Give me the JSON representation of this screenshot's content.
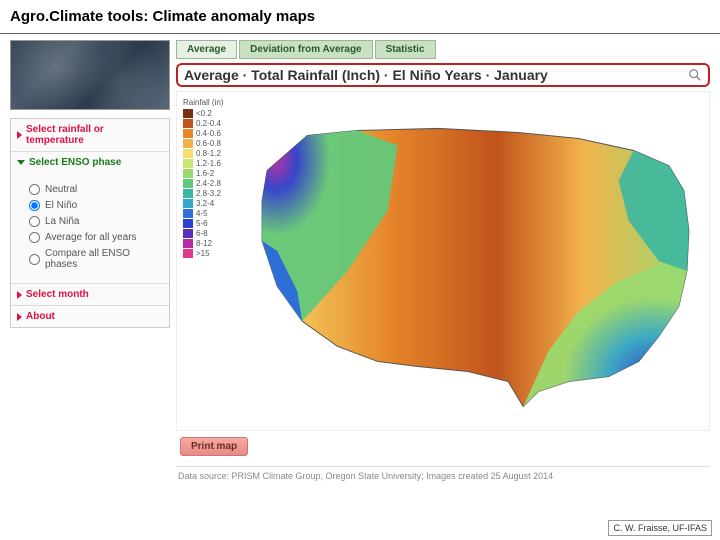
{
  "title": "Agro.Climate tools: Climate anomaly maps",
  "sidebar": {
    "items": [
      {
        "label": "Select rainfall or temperature",
        "open": false
      },
      {
        "label": "Select ENSO phase",
        "open": true
      },
      {
        "label": "Select month",
        "open": false
      },
      {
        "label": "About",
        "open": false
      }
    ],
    "enso_options": [
      {
        "label": "Neutral",
        "checked": false
      },
      {
        "label": "El Niño",
        "checked": true
      },
      {
        "label": "La Niña",
        "checked": false
      },
      {
        "label": "Average for all years",
        "checked": false
      },
      {
        "label": "Compare all ENSO phases",
        "checked": false
      }
    ]
  },
  "tabs": [
    {
      "label": "Average",
      "active": true
    },
    {
      "label": "Deviation from Average",
      "active": false
    },
    {
      "label": "Statistic",
      "active": false
    }
  ],
  "subtitle": "Average · Total Rainfall (Inch) · El Niño Years · January",
  "legend": {
    "title": "Rainfall (in)",
    "rows": [
      {
        "color": "#7a2f12",
        "label": "<0.2"
      },
      {
        "color": "#c1541b",
        "label": "0.2-0.4"
      },
      {
        "color": "#e6852a",
        "label": "0.4-0.6"
      },
      {
        "color": "#f2b24b",
        "label": "0.6-0.8"
      },
      {
        "color": "#f5df6a",
        "label": "0.8-1.2"
      },
      {
        "color": "#cbe66e",
        "label": "1.2-1.6"
      },
      {
        "color": "#9ad96e",
        "label": "1.6-2"
      },
      {
        "color": "#63c97a",
        "label": "2.4-2.8"
      },
      {
        "color": "#3cb7a0",
        "label": "2.8-3.2"
      },
      {
        "color": "#34a6c9",
        "label": "3.2-4"
      },
      {
        "color": "#2e6fd6",
        "label": "4-5"
      },
      {
        "color": "#2d3fd0",
        "label": "5-6"
      },
      {
        "color": "#5a2fb8",
        "label": "6-8"
      },
      {
        "color": "#b62aa3",
        "label": "8-12"
      },
      {
        "color": "#e0398e",
        "label": ">15"
      }
    ]
  },
  "print_label": "Print map",
  "data_source": "Data source: PRISM Climate Group, Oregon State University; Images created 25 August 2014",
  "credit": "C. W. Fraisse, UF-IFAS"
}
